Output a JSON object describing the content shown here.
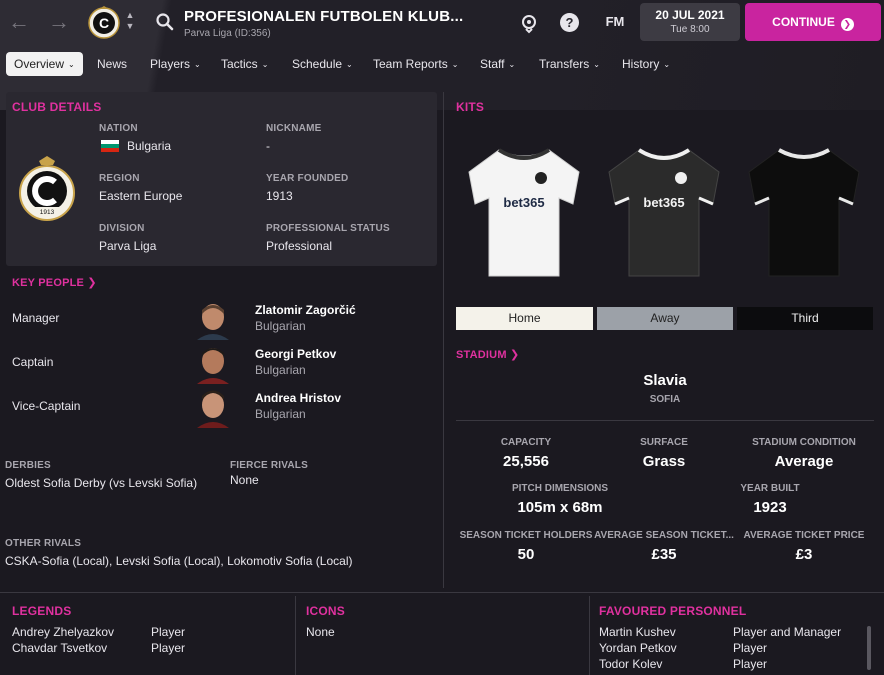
{
  "header": {
    "club_name": "PROFESIONALEN FUTBOLEN KLUB...",
    "subtitle": "Parva Liga (ID:356)",
    "badge_letter": "C",
    "fm_label": "FM",
    "help_label": "?",
    "date": "20 JUL 2021",
    "time": "Tue 8:00",
    "continue_label": "CONTINUE"
  },
  "tabs": [
    {
      "label": "Overview",
      "has_menu": true,
      "active": true
    },
    {
      "label": "News",
      "has_menu": false
    },
    {
      "label": "Players",
      "has_menu": true
    },
    {
      "label": "Tactics",
      "has_menu": true
    },
    {
      "label": "Schedule",
      "has_menu": true
    },
    {
      "label": "Team Reports",
      "has_menu": true
    },
    {
      "label": "Staff",
      "has_menu": true
    },
    {
      "label": "Transfers",
      "has_menu": true
    },
    {
      "label": "History",
      "has_menu": true
    }
  ],
  "club_details": {
    "title": "CLUB DETAILS",
    "badge_year": "1913",
    "nation_label": "NATION",
    "nation": "Bulgaria",
    "nickname_label": "NICKNAME",
    "nickname": "-",
    "region_label": "REGION",
    "region": "Eastern Europe",
    "founded_label": "YEAR FOUNDED",
    "founded": "1913",
    "division_label": "DIVISION",
    "division": "Parva Liga",
    "status_label": "PROFESSIONAL STATUS",
    "status": "Professional"
  },
  "key_people": {
    "title": "KEY PEOPLE",
    "people": [
      {
        "role": "Manager",
        "name": "Zlatomir Zagorčić",
        "nationality": "Bulgarian"
      },
      {
        "role": "Captain",
        "name": "Georgi Petkov",
        "nationality": "Bulgarian"
      },
      {
        "role": "Vice-Captain",
        "name": "Andrea Hristov",
        "nationality": "Bulgarian"
      }
    ]
  },
  "rivals": {
    "derbies_label": "DERBIES",
    "derbies": "Oldest Sofia Derby (vs Levski Sofia)",
    "fierce_label": "FIERCE RIVALS",
    "fierce": "None",
    "other_label": "OTHER RIVALS",
    "other": "CSKA-Sofia (Local), Levski Sofia (Local), Lokomotiv Sofia (Local)"
  },
  "kits": {
    "title": "KITS",
    "sponsor": "bet365",
    "tabs": [
      "Home",
      "Away",
      "Third"
    ],
    "colors": {
      "home": "#f4f4f4",
      "away": "#2b2b2b",
      "third": "#0d0d0d",
      "accent": "#c9249f"
    }
  },
  "stadium": {
    "title": "STADIUM",
    "name": "Slavia",
    "city": "SOFIA",
    "capacity_label": "CAPACITY",
    "capacity": "25,556",
    "surface_label": "SURFACE",
    "surface": "Grass",
    "condition_label": "STADIUM CONDITION",
    "condition": "Average",
    "dimensions_label": "PITCH DIMENSIONS",
    "dimensions": "105m x 68m",
    "built_label": "YEAR BUILT",
    "built": "1923",
    "season_ticket_label": "SEASON TICKET HOLDERS",
    "season_ticket": "50",
    "avg_season_label": "AVERAGE SEASON TICKET...",
    "avg_season": "£35",
    "avg_ticket_label": "AVERAGE TICKET PRICE",
    "avg_ticket": "£3"
  },
  "legends": {
    "title": "LEGENDS",
    "rows": [
      {
        "name": "Andrey Zhelyazkov",
        "role": "Player"
      },
      {
        "name": "Chavdar Tsvetkov",
        "role": "Player"
      }
    ]
  },
  "icons": {
    "title": "ICONS",
    "value": "None"
  },
  "favoured": {
    "title": "FAVOURED PERSONNEL",
    "rows": [
      {
        "name": "Martin Kushev",
        "role": "Player and Manager"
      },
      {
        "name": "Yordan Petkov",
        "role": "Player"
      },
      {
        "name": "Todor Kolev",
        "role": "Player"
      }
    ]
  }
}
